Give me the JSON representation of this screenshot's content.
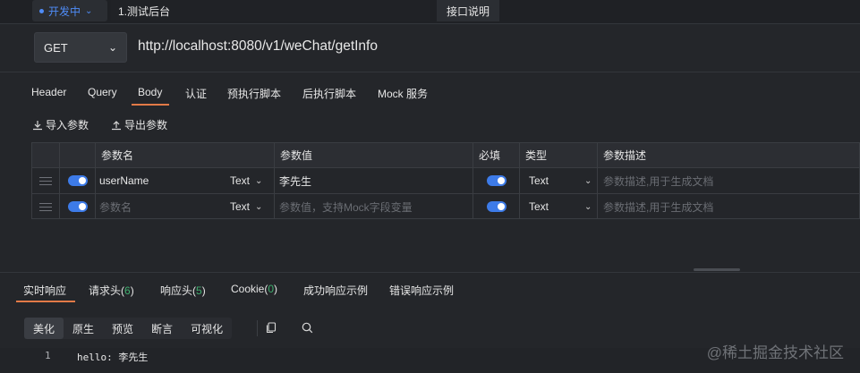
{
  "top": {
    "status_label": "开发中",
    "api_name": "1.测试后台",
    "doc_button": "接口说明"
  },
  "request": {
    "method": "GET",
    "url": "http://localhost:8080/v1/weChat/getInfo"
  },
  "tabs": [
    "Header",
    "Query",
    "Body",
    "认证",
    "预执行脚本",
    "后执行脚本",
    "Mock 服务"
  ],
  "active_tab": "Body",
  "import_label": "导入参数",
  "export_label": "导出参数",
  "table": {
    "headers": [
      "参数名",
      "参数值",
      "必填",
      "类型",
      "参数描述"
    ],
    "rows": [
      {
        "name": "userName",
        "name_type": "Text",
        "value": "李先生",
        "required": true,
        "type": "Text",
        "desc_placeholder": "参数描述,用于生成文档"
      },
      {
        "name_placeholder": "参数名",
        "name_type": "Text",
        "value_placeholder": "参数值，支持Mock字段变量",
        "required": true,
        "type": "Text",
        "desc_placeholder": "参数描述,用于生成文档"
      }
    ]
  },
  "response_tabs": {
    "live": "实时响应",
    "req_headers": "请求头",
    "req_headers_count": "6",
    "res_headers": "响应头",
    "res_headers_count": "5",
    "cookie": "Cookie",
    "cookie_count": "0",
    "success_example": "成功响应示例",
    "error_example": "错误响应示例"
  },
  "view_modes": [
    "美化",
    "原生",
    "预览",
    "断言",
    "可视化"
  ],
  "active_view_mode": "美化",
  "response_body": {
    "line_number": "1",
    "content": "hello: 李先生"
  },
  "watermark": "@稀土掘金技术社区",
  "colors": {
    "accent": "#e27a47",
    "toggle_on": "#3d7be8",
    "status_dev": "#4f8cf7",
    "count_green": "#3fae6e"
  }
}
